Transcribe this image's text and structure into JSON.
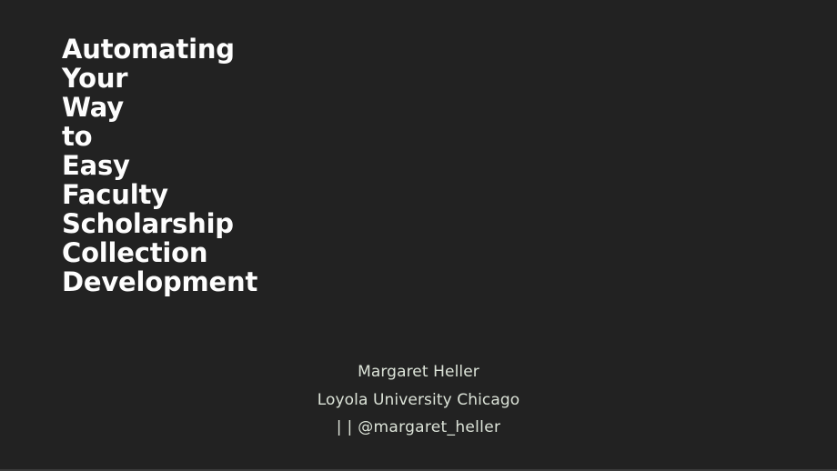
{
  "slide": {
    "background_color": "#222222",
    "bottom_border_color": "#3b3b3b",
    "title": {
      "color": "#fdfdfd",
      "lines": [
        "Automating",
        "Your",
        "Way",
        "to",
        "Easy",
        "Faculty",
        "Scholarship",
        "Collection",
        "Development"
      ]
    },
    "subtitle": {
      "color": "#dce3d8",
      "presenter": "Margaret Heller",
      "affiliation": "Loyola University Chicago",
      "handle": "| | @margaret_heller"
    }
  }
}
